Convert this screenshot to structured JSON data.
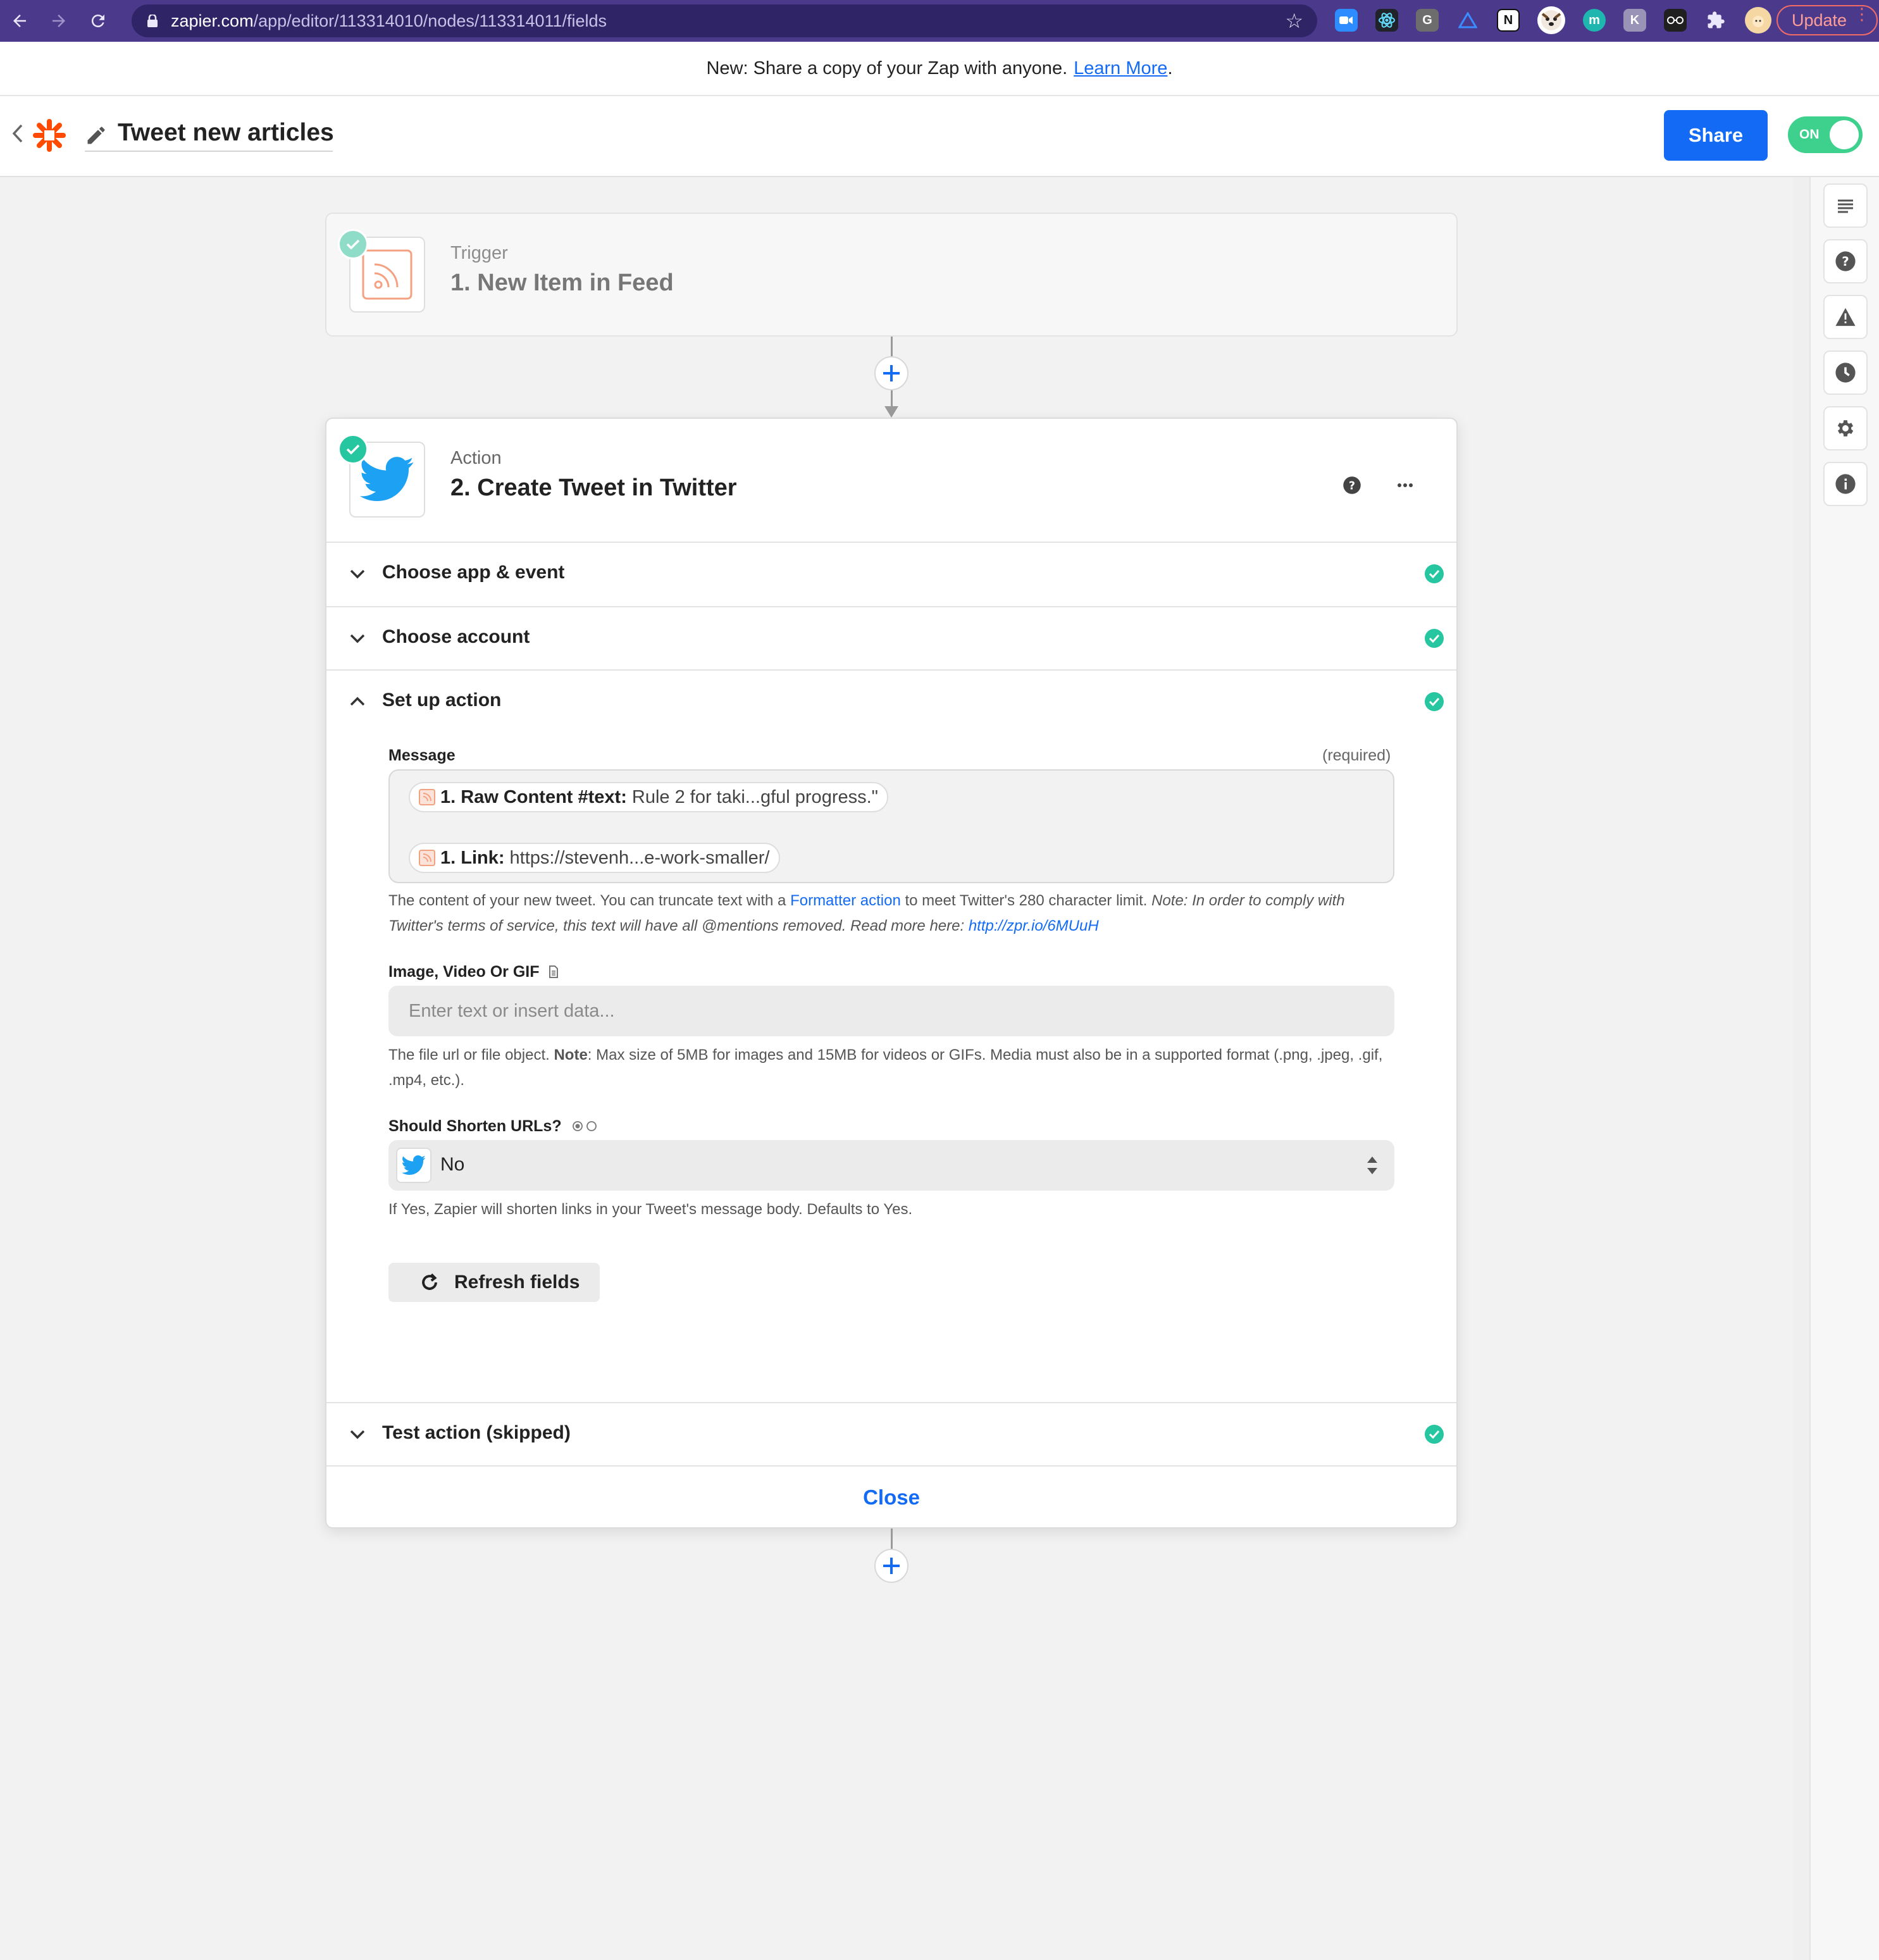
{
  "browser": {
    "url_host": "zapier.com",
    "url_path": "/app/editor/113314010/nodes/113314011/fields",
    "update_label": "Update",
    "extensions": [
      {
        "name": "zoom-extension-icon",
        "label": "",
        "color": "#2d8cff"
      },
      {
        "name": "react-devtools-icon",
        "label": "",
        "color": "#20232a"
      },
      {
        "name": "grammarly-icon",
        "label": "G",
        "color": "#6d6d6d"
      },
      {
        "name": "triangle-extension-icon",
        "label": "",
        "color": "#4b3a8c"
      },
      {
        "name": "notion-icon",
        "label": "N",
        "color": "#ffffff"
      },
      {
        "name": "dog-avatar-icon",
        "label": "",
        "color": "#ffffff"
      },
      {
        "name": "m-extension-icon",
        "label": "m",
        "color": "#1fb6b0"
      },
      {
        "name": "k-extension-icon",
        "label": "K",
        "color": "#9a93b8"
      },
      {
        "name": "glasses-extension-icon",
        "label": "",
        "color": "#202020"
      },
      {
        "name": "puzzle-extensions-icon",
        "label": "",
        "color": "#4b3a8c"
      }
    ]
  },
  "announcement": {
    "text": "New: Share a copy of your Zap with anyone.",
    "link": "Learn More",
    "trail": "."
  },
  "header": {
    "zap_title": "Tweet new articles",
    "share_label": "Share",
    "toggle_label": "ON"
  },
  "trigger": {
    "kind": "Trigger",
    "title": "1. New Item in Feed"
  },
  "action": {
    "kind": "Action",
    "title": "2. Create Tweet in Twitter",
    "sections": {
      "choose_app": "Choose app & event",
      "choose_account": "Choose account",
      "setup": "Set up action",
      "test": "Test action (skipped)"
    },
    "close_label": "Close"
  },
  "fields": {
    "message": {
      "label": "Message",
      "required": "(required)",
      "pills": [
        {
          "key": "1. Raw Content #text:",
          "value": "Rule 2 for taki...gful progress.\""
        },
        {
          "key": "1. Link:",
          "value": "https://stevenh...e-work-smaller/"
        }
      ],
      "help_prefix": "The content of your new tweet. You can truncate text with a",
      "help_link": "Formatter action",
      "help_middle": "to meet Twitter's 280 character limit.",
      "help_italic": "Note: In order to comply with Twitter's terms of service, this text will have all @mentions removed. Read more here:",
      "help_url": "http://zpr.io/6MUuH"
    },
    "media": {
      "label": "Image, Video Or GIF",
      "placeholder": "Enter text or insert data...",
      "help_prefix": "The file url or file object.",
      "help_bold": "Note",
      "help_rest": ": Max size of 5MB for images and 15MB for videos or GIFs. Media must also be in a supported format (.png, .jpeg, .gif, .mp4, etc.)."
    },
    "shorten": {
      "label": "Should Shorten URLs?",
      "value": "No",
      "help": "If Yes, Zapier will shorten links in your Tweet's message body. Defaults to Yes."
    },
    "refresh_label": "Refresh fields"
  },
  "colors": {
    "accent": "#136bf5",
    "success": "#26c6a0",
    "zapier_orange": "#ff4a00",
    "twitter_blue": "#1da1f2",
    "browser_purple": "#4b3a8c"
  },
  "side_panel": [
    "outline-icon",
    "help-icon",
    "alert-icon",
    "history-icon",
    "settings-icon",
    "info-icon"
  ]
}
